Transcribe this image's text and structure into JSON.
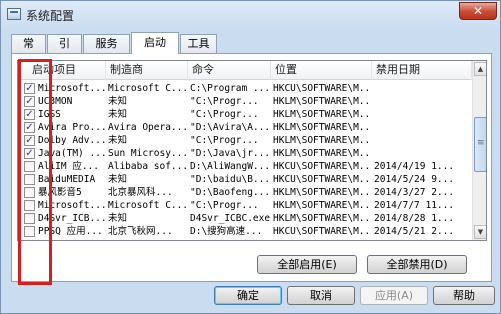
{
  "window": {
    "title": "系统配置",
    "close_label": "✕"
  },
  "tabs": [
    {
      "label": "常规"
    },
    {
      "label": "引导"
    },
    {
      "label": "服务"
    },
    {
      "label": "启动"
    },
    {
      "label": "工具"
    }
  ],
  "active_tab": "启动",
  "columns": [
    "启动项目",
    "制造商",
    "命令",
    "位置",
    "禁用日期"
  ],
  "rows": [
    {
      "checked": true,
      "item": "Microsoft...",
      "maker": "Microsoft C...",
      "command": "C:\\Program ...",
      "location": "HKCU\\SOFTWARE\\M...",
      "date": ""
    },
    {
      "checked": true,
      "item": "UC3MON",
      "maker": "未知",
      "command": "\"C:\\Progr...",
      "location": "HKLM\\SOFTWARE\\M...",
      "date": ""
    },
    {
      "checked": true,
      "item": "IGSS",
      "maker": "未知",
      "command": "\"C:\\Progr...",
      "location": "HKLM\\SOFTWARE\\M...",
      "date": ""
    },
    {
      "checked": true,
      "item": "Avira Pro...",
      "maker": "Avira Opera...",
      "command": "\"D:\\Avira\\A...",
      "location": "HKLM\\SOFTWARE\\M...",
      "date": ""
    },
    {
      "checked": true,
      "item": "Dolby Adv...",
      "maker": "未知",
      "command": "\"C:\\Progr...",
      "location": "HKLM\\SOFTWARE\\M...",
      "date": ""
    },
    {
      "checked": true,
      "item": "Java(TM) ...",
      "maker": "Sun Microsy...",
      "command": "\"D:\\Java\\jr...",
      "location": "HKLM\\SOFTWARE\\M...",
      "date": ""
    },
    {
      "checked": false,
      "item": "AliIM 应...",
      "maker": "Alibaba sof...",
      "command": "D:\\AliWangW...",
      "location": "HKCU\\SOFTWARE\\M...",
      "date": "2014/4/19 1..."
    },
    {
      "checked": false,
      "item": "BaiduMEDIA",
      "maker": "未知",
      "command": "\"D:\\baidu\\B...",
      "location": "HKCU\\SOFTWARE\\M...",
      "date": "2014/5/24 9..."
    },
    {
      "checked": false,
      "item": "暴风影音5",
      "maker": "北京暴风科...",
      "command": "\"D:\\Baofeng...",
      "location": "HKLM\\SOFTWARE\\M...",
      "date": "2014/3/27 2..."
    },
    {
      "checked": false,
      "item": "Microsoft...",
      "maker": "Microsoft C...",
      "command": "\"C:\\Progr...",
      "location": "HKLM\\SOFTWARE\\M...",
      "date": "2014/7/7 11..."
    },
    {
      "checked": false,
      "item": "D4Svr_ICB...",
      "maker": "未知",
      "command": "D4Svr_ICBC.exe",
      "location": "HKLM\\SOFTWARE\\M...",
      "date": "2014/8/28 1..."
    },
    {
      "checked": false,
      "item": "PPSQ 应用...",
      "maker": "北京飞秋网...",
      "command": "D:\\搜狗高速...",
      "location": "HKCU\\SOFTWARE\\M...",
      "date": "2014/5/21 2..."
    }
  ],
  "buttons": {
    "enable_all": "全部启用(E)",
    "disable_all": "全部禁用(D)",
    "ok": "确定",
    "cancel": "取消",
    "apply": "应用(A)",
    "help": "帮助"
  },
  "colors": {
    "highlight": "#d61f1f",
    "accent": "#3c7fb1"
  }
}
